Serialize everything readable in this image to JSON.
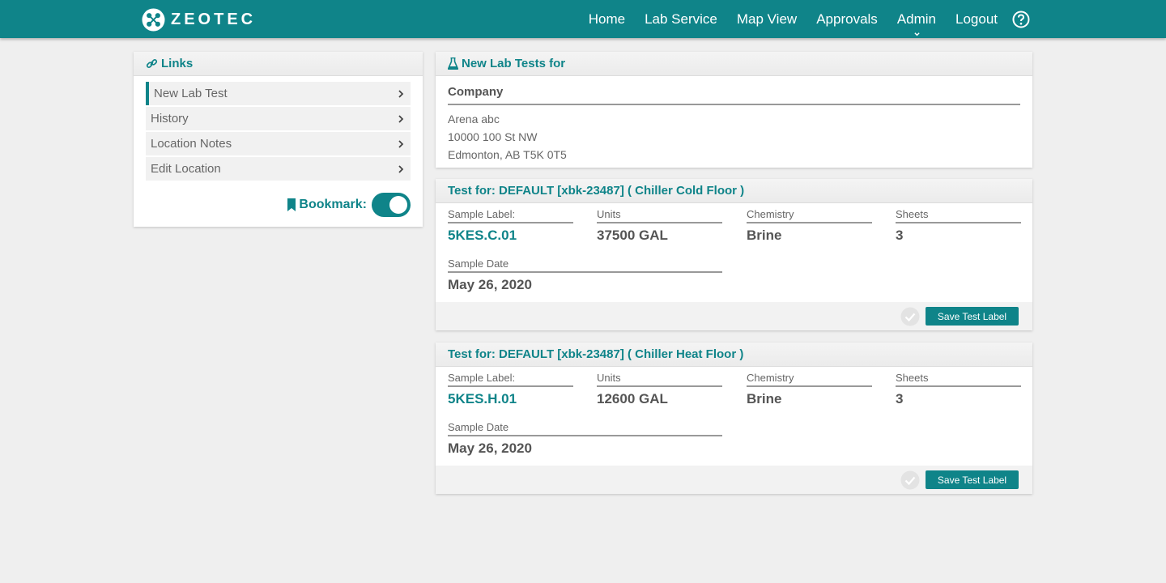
{
  "brand": {
    "name": "ZEOTEC",
    "accent_color": "#0f8489"
  },
  "nav": {
    "items": [
      {
        "label": "Home"
      },
      {
        "label": "Lab Service"
      },
      {
        "label": "Map View"
      },
      {
        "label": "Approvals"
      },
      {
        "label": "Admin"
      },
      {
        "label": "Logout"
      }
    ],
    "help_icon": "help-circle-icon"
  },
  "links_panel": {
    "title": "Links",
    "items": [
      {
        "label": "New Lab Test",
        "active": true
      },
      {
        "label": "History"
      },
      {
        "label": "Location Notes"
      },
      {
        "label": "Edit Location"
      }
    ],
    "bookmark_label": "Bookmark:",
    "bookmark_on": true
  },
  "company_panel": {
    "title": "New Lab Tests for",
    "section_title": "Company",
    "lines": [
      "Arena abc",
      "10000 100 St NW",
      "Edmonton, AB T5K 0T5"
    ]
  },
  "tests": [
    {
      "title": "Test for: DEFAULT [xbk-23487] ( Chiller Cold Floor )",
      "sample_label_label": "Sample Label:",
      "sample_label": "5KES.C.01",
      "units_label": "Units",
      "units": "37500 GAL",
      "chemistry_label": "Chemistry",
      "chemistry": "Brine",
      "sheets_label": "Sheets",
      "sheets": "3",
      "date_label": "Sample Date",
      "date": "May 26, 2020",
      "save_label": "Save Test Label"
    },
    {
      "title": "Test for: DEFAULT [xbk-23487] ( Chiller Heat Floor )",
      "sample_label_label": "Sample Label:",
      "sample_label": "5KES.H.01",
      "units_label": "Units",
      "units": "12600 GAL",
      "chemistry_label": "Chemistry",
      "chemistry": "Brine",
      "sheets_label": "Sheets",
      "sheets": "3",
      "date_label": "Sample Date",
      "date": "May 26, 2020",
      "save_label": "Save Test Label"
    }
  ]
}
